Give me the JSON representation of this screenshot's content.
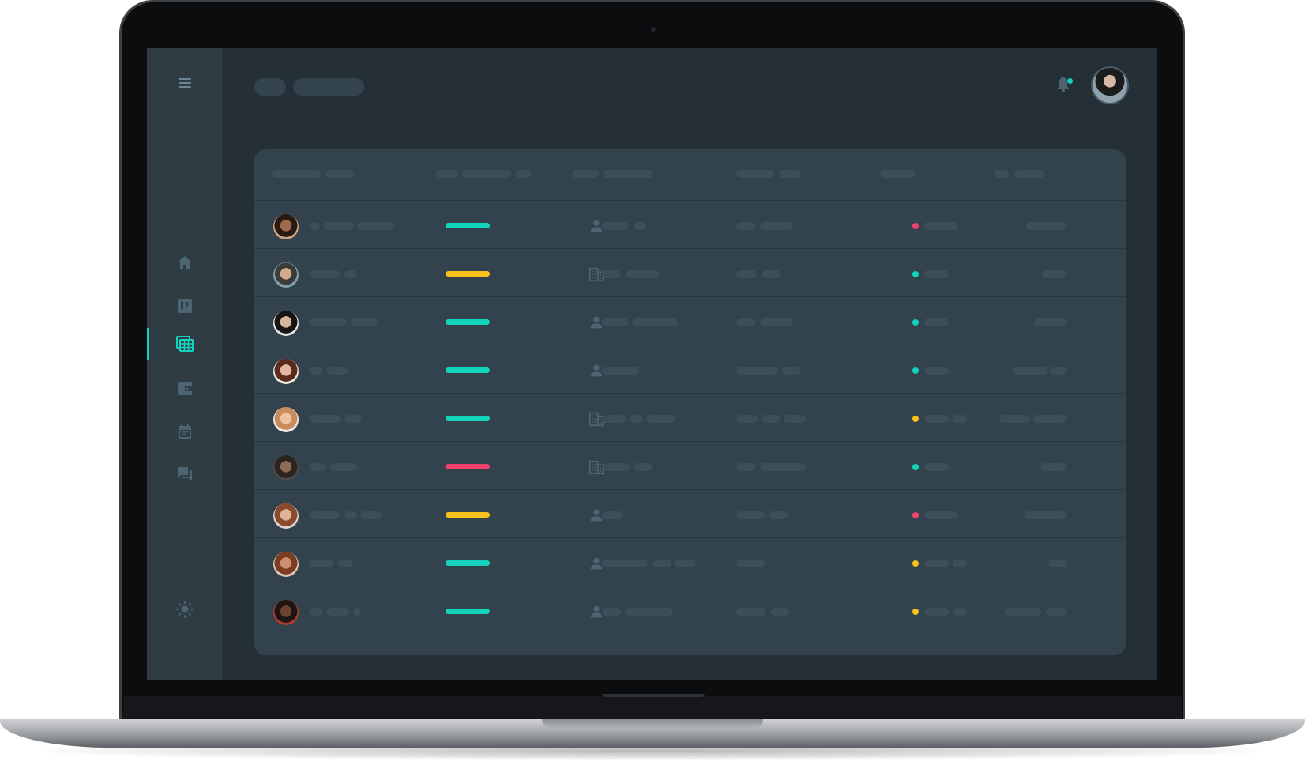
{
  "colors": {
    "accent": "#13d3bc",
    "warning": "#f8c11c",
    "danger": "#f0416f",
    "background": "#252f36",
    "sidebar": "#2f3c44",
    "card": "#33434d",
    "placeholder": "#3d4e59",
    "icon": "#4d6472"
  },
  "sidebar": {
    "items": [
      {
        "icon": "menu-icon"
      },
      {
        "icon": "home-icon"
      },
      {
        "icon": "board-icon"
      },
      {
        "icon": "table-icon",
        "active": true
      },
      {
        "icon": "wallet-icon"
      },
      {
        "icon": "calendar-icon"
      },
      {
        "icon": "chat-icon"
      },
      {
        "icon": "theme-toggle-icon"
      }
    ]
  },
  "header": {
    "breadcrumb_segments": 2,
    "notification_icon": "bell-icon",
    "notification_unread": true,
    "user_avatar": "user-avatar"
  },
  "table": {
    "columns": 6,
    "rows": [
      {
        "avatar": "person-1-avatar",
        "status_color": "#13d3bc",
        "type_icon": "person-icon",
        "state_color": "#f0416f"
      },
      {
        "avatar": "person-2-avatar",
        "status_color": "#f8c11c",
        "type_icon": "building-icon",
        "state_color": "#13d3bc"
      },
      {
        "avatar": "person-3-avatar",
        "status_color": "#13d3bc",
        "type_icon": "person-icon",
        "state_color": "#13d3bc"
      },
      {
        "avatar": "person-4-avatar",
        "status_color": "#13d3bc",
        "type_icon": "person-icon",
        "state_color": "#13d3bc"
      },
      {
        "avatar": "person-5-avatar",
        "status_color": "#13d3bc",
        "type_icon": "building-icon",
        "state_color": "#f8c11c"
      },
      {
        "avatar": "person-6-avatar",
        "status_color": "#f0416f",
        "type_icon": "building-icon",
        "state_color": "#13d3bc"
      },
      {
        "avatar": "person-7-avatar",
        "status_color": "#f8c11c",
        "type_icon": "person-icon",
        "state_color": "#f0416f"
      },
      {
        "avatar": "person-8-avatar",
        "status_color": "#13d3bc",
        "type_icon": "person-icon",
        "state_color": "#f8c11c"
      },
      {
        "avatar": "person-9-avatar",
        "status_color": "#13d3bc",
        "type_icon": "person-icon",
        "state_color": "#f8c11c"
      }
    ]
  }
}
